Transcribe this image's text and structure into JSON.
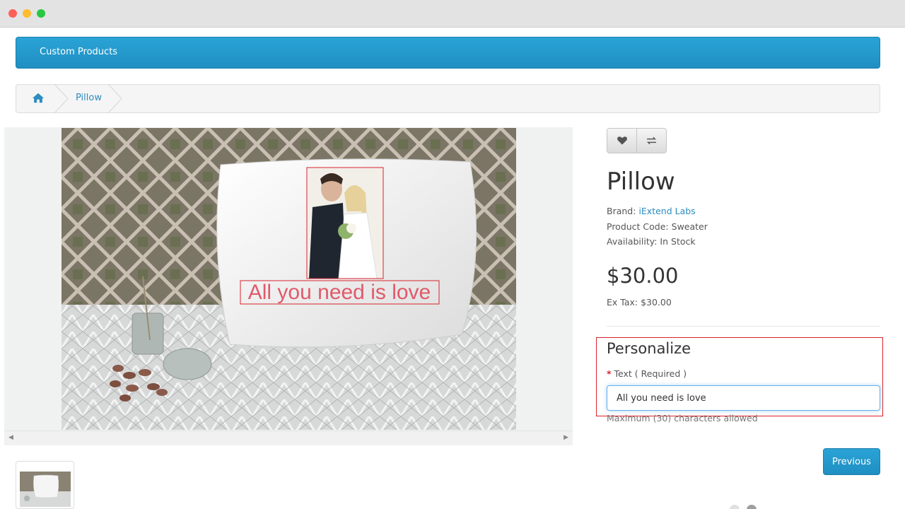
{
  "window": {
    "controls": [
      "close",
      "minimize",
      "maximize"
    ]
  },
  "navbar": {
    "link_label": "Custom Products"
  },
  "breadcrumb": {
    "home_icon": "home-icon",
    "current": "Pillow"
  },
  "product": {
    "title": "Pillow",
    "brand_label": "Brand:",
    "brand_value": "iExtend Labs",
    "code_label": "Product Code:",
    "code_value": "Sweater",
    "availability_label": "Availability:",
    "availability_value": "In Stock",
    "price": "$30.00",
    "extax_label": "Ex Tax:",
    "extax_value": "$30.00",
    "preview_text": "All you need is love"
  },
  "actions": {
    "wishlist_icon": "heart-icon",
    "compare_icon": "compare-icon"
  },
  "personalize": {
    "title": "Personalize",
    "required_marker": "*",
    "field_label": "Text ( Required )",
    "field_value": "All you need is love",
    "help": "Maximum (30) characters allowed"
  },
  "nav_buttons": {
    "previous_label": "Previous"
  },
  "colors": {
    "accent": "#2aa3d6",
    "highlight_border": "#d9232b",
    "preview_text": "#e05a6a"
  }
}
